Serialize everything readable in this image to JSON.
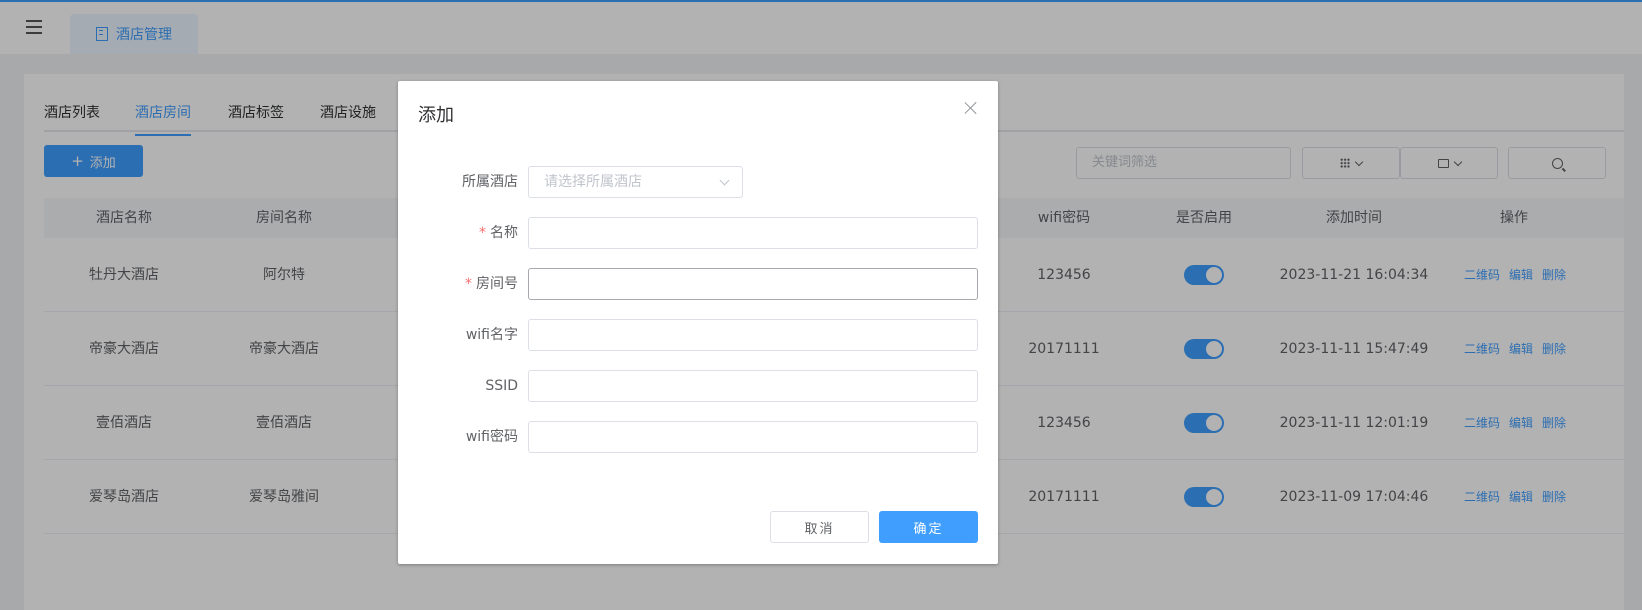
{
  "header": {
    "active_tab": "酒店管理"
  },
  "sub_tabs": [
    "酒店列表",
    "酒店房间",
    "酒店标签",
    "酒店设施"
  ],
  "toolbar": {
    "add_label": "添加",
    "keyword_placeholder": "关键词筛选"
  },
  "table": {
    "columns": [
      "酒店名称",
      "房间名称",
      "wifi密码",
      "是否启用",
      "添加时间",
      "操作"
    ],
    "rows": [
      {
        "hotel": "牡丹大酒店",
        "room": "阿尔特",
        "wifi_pwd": "123456",
        "enabled": true,
        "time": "2023-11-21 16:04:34"
      },
      {
        "hotel": "帝豪大酒店",
        "room": "帝豪大酒店",
        "wifi_pwd": "20171111",
        "enabled": true,
        "time": "2023-11-11 15:47:49"
      },
      {
        "hotel": "壹佰酒店",
        "room": "壹佰酒店",
        "wifi_pwd": "123456",
        "enabled": true,
        "time": "2023-11-11 12:01:19"
      },
      {
        "hotel": "爱琴岛酒店",
        "room": "爱琴岛雅间",
        "wifi_pwd": "20171111",
        "enabled": true,
        "time": "2023-11-09 17:04:46"
      }
    ],
    "ops": [
      "二维码",
      "编辑",
      "删除"
    ]
  },
  "dialog": {
    "title": "添加",
    "fields": {
      "hotel": {
        "label": "所属酒店",
        "placeholder": "请选择所属酒店"
      },
      "name": {
        "label": "名称",
        "required": "*"
      },
      "room_no": {
        "label": "房间号",
        "required": "*"
      },
      "wifi_name": {
        "label": "wifi名字"
      },
      "ssid": {
        "label": "SSID"
      },
      "wifi_pwd": {
        "label": "wifi密码"
      }
    },
    "cancel_label": "取消",
    "ok_label": "确定"
  },
  "colors": {
    "primary": "#409eff",
    "danger": "#f56c6c"
  }
}
